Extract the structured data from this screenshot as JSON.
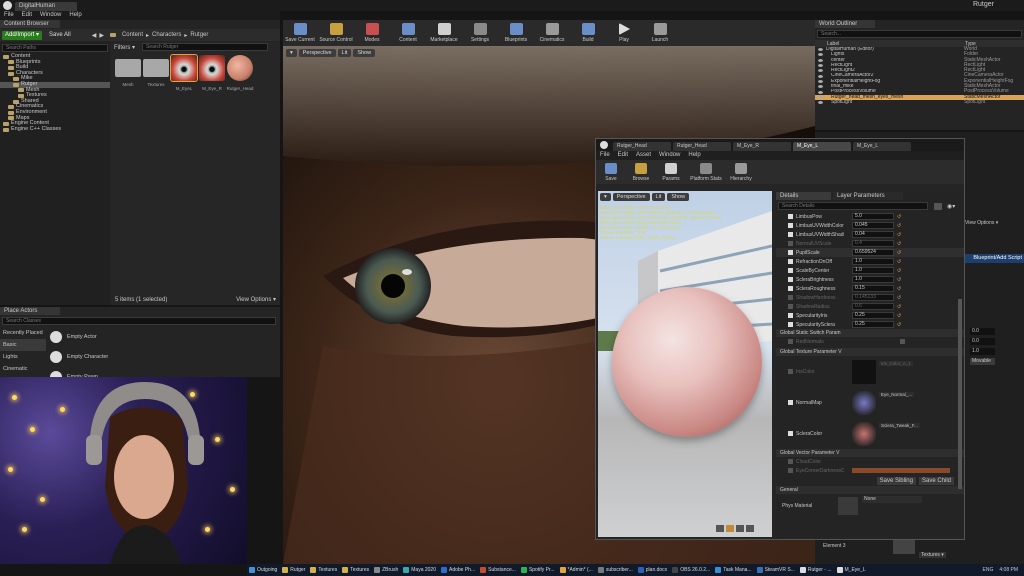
{
  "app": {
    "window_tab": "DigitalHuman",
    "user": "Rutger",
    "menu": [
      "File",
      "Edit",
      "Window",
      "Help"
    ]
  },
  "content_browser": {
    "tab": "Content Browser",
    "add_import": "Add/Import ▾",
    "save_all": "Save All",
    "breadcrumb": [
      "Content",
      "Characters",
      "Rutger"
    ],
    "filters": "Filters ▾",
    "search_assets_placeholder": "Search Rutger",
    "search_paths_placeholder": "Search Paths",
    "tree": [
      {
        "label": "Content",
        "depth": 0
      },
      {
        "label": "Blueprints",
        "depth": 1
      },
      {
        "label": "Build",
        "depth": 1
      },
      {
        "label": "Characters",
        "depth": 1
      },
      {
        "label": "Mike",
        "depth": 2
      },
      {
        "label": "Rutger",
        "depth": 2,
        "selected": true
      },
      {
        "label": "Mesh",
        "depth": 3
      },
      {
        "label": "Textures",
        "depth": 3
      },
      {
        "label": "Shared",
        "depth": 2
      },
      {
        "label": "Cinematics",
        "depth": 1
      },
      {
        "label": "Environment",
        "depth": 1
      },
      {
        "label": "Maps",
        "depth": 1
      },
      {
        "label": "Engine Content",
        "depth": 0
      },
      {
        "label": "Engine C++ Classes",
        "depth": 0
      }
    ],
    "assets": [
      {
        "label": "Mesh",
        "kind": "folder"
      },
      {
        "label": "Textures",
        "kind": "folder"
      },
      {
        "label": "M_EyeL",
        "kind": "eye",
        "selected": true
      },
      {
        "label": "M_Eye_R",
        "kind": "eye"
      },
      {
        "label": "Rutger_Head",
        "kind": "skin"
      }
    ],
    "status": "5 items (1 selected)",
    "view_options": "View Options ▾"
  },
  "place_actors": {
    "tab": "Place Actors",
    "search_placeholder": "Search Classes",
    "categories": [
      "Recently Placed",
      "Basic",
      "Lights",
      "Cinematic"
    ],
    "selected_category": "Basic",
    "actors": [
      "Empty Actor",
      "Empty Character",
      "Empty Pawn"
    ]
  },
  "toolbar": {
    "buttons": [
      "Save Current",
      "Source Control",
      "Modes",
      "Content",
      "Marketplace",
      "Settings",
      "Blueprints",
      "Cinematics",
      "Build",
      "Play",
      "Launch"
    ]
  },
  "viewport": {
    "chips": [
      "Perspective",
      "Lit",
      "Show"
    ]
  },
  "world_outliner": {
    "tab": "World Outliner",
    "search_placeholder": "Search...",
    "col_label": "Label",
    "col_type": "Type",
    "rows": [
      {
        "label": "DigitalHuman (Editor)",
        "type": "World"
      },
      {
        "label": "Lights",
        "type": "Folder"
      },
      {
        "label": "center",
        "type": "StaticMeshActor"
      },
      {
        "label": "RectLight",
        "type": "RectLight"
      },
      {
        "label": "RectLight2",
        "type": "RectLight"
      },
      {
        "label": "CineCameraActor2",
        "type": "CineCameraActor"
      },
      {
        "label": "ExponentialHeightFog",
        "type": "ExponentialHeightFog"
      },
      {
        "label": "final_mike",
        "type": "StaticMeshActor"
      },
      {
        "label": "PostProcessVolume",
        "type": "PostProcessVolume"
      },
      {
        "label": "Rutger_head_mesh_eyes_mesh",
        "type": "StaticMeshActor",
        "selected": true
      },
      {
        "label": "SpotLight",
        "type": "SpotLight"
      }
    ],
    "view_options": "View Options ▾",
    "blueprint_button": "Blueprint/Add Script",
    "movable": "Movable",
    "values": [
      "0.0",
      "0.0",
      "1.0"
    ],
    "element": "Element 3",
    "textures": "Textures ▾"
  },
  "material_editor": {
    "tabs": [
      "Rutger_Head",
      "Rutger_Head",
      "M_Eye_R",
      "M_Eye_L",
      "M_Eye_L"
    ],
    "active_tab": 3,
    "menu": [
      "File",
      "Edit",
      "Asset",
      "Window",
      "Help"
    ],
    "toolbar": [
      "Save",
      "Browse",
      "Params",
      "Platform Stats",
      "Hierarchy"
    ],
    "preview_chips": [
      "Perspective",
      "Lit",
      "Show"
    ],
    "stats": [
      "Base pass shader: 345 instructions",
      "Base pass shader with Surface Lightmap: 372 instructions",
      "Base pass shader with Volumetric Lightmap: 389 instructions",
      "Base pass vertex shader: 86 instructions",
      "Base pass vertex shader: 91 instructions",
      "Texture samplers: 7/16",
      "Texture Lookups (Est.): VS(0), PS(11)"
    ],
    "details_tabs": [
      "Details",
      "Layer Parameters"
    ],
    "search_details": "Search Details",
    "params": [
      {
        "label": "LimbusPow",
        "value": "5.0"
      },
      {
        "label": "LimbusUVWidthColor",
        "value": "0.045"
      },
      {
        "label": "LimbusUVWidthShading",
        "value": "0.04"
      },
      {
        "label": "NormalUVScale",
        "value": "0.4",
        "disabled": true
      },
      {
        "label": "PupilScale",
        "value": "0.659524",
        "highlight": true
      },
      {
        "label": "RefractionOnOff",
        "value": "1.0"
      },
      {
        "label": "ScaleByCenter",
        "value": "1.0"
      },
      {
        "label": "ScleraBrightness",
        "value": "1.0"
      },
      {
        "label": "ScleraRoughness",
        "value": "0.15"
      },
      {
        "label": "ShadowHardness",
        "value": "0.145133",
        "disabled": true
      },
      {
        "label": "ShadowRadius",
        "value": "0.6",
        "disabled": true
      },
      {
        "label": "SpecularityIris",
        "value": "0.25"
      },
      {
        "label": "SpecularitySclera",
        "value": "0.25"
      }
    ],
    "static_switch_section": "Global Static Switch Param",
    "static_switch_param": "RedNormals",
    "texture_section": "Global Texture Parameter V",
    "texture_params": [
      {
        "label": "IrisColor",
        "asset": "Iris_Color_A_1",
        "disabled": true
      },
      {
        "label": "NormalMap",
        "asset": "Eye_Normal_...",
        "color": "#7a78c8"
      },
      {
        "label": "ScleraColor",
        "asset": "Sclera_Tweak_F...",
        "color": "#c87470"
      }
    ],
    "vector_section": "Global Vector Parameter V",
    "vector_params": [
      "CloudColor",
      "EyeCornerDarknessCo"
    ],
    "save_sibling": "Save Sibling",
    "save_child": "Save Child",
    "general_section": "General",
    "phys_material": "Phys Material",
    "phys_value": "None"
  },
  "taskbar": [
    {
      "label": "Outgoing",
      "color": "#4a8fd4"
    },
    {
      "label": "Rutger",
      "color": "#d4b04a"
    },
    {
      "label": "Textures",
      "color": "#d4b04a"
    },
    {
      "label": "Textures",
      "color": "#d4b04a"
    },
    {
      "label": "ZBrush",
      "color": "#888888"
    },
    {
      "label": "Maya 2020",
      "color": "#3aa9a9"
    },
    {
      "label": "Adobe Ph...",
      "color": "#2f6bd4"
    },
    {
      "label": "Substance...",
      "color": "#c84a2a"
    },
    {
      "label": "Spotify Pr...",
      "color": "#2ab54a"
    },
    {
      "label": "*Admin* (...",
      "color": "#e6a33a"
    },
    {
      "label": "subscriber...",
      "color": "#777777"
    },
    {
      "label": "plan.docx",
      "color": "#2f5fb4"
    },
    {
      "label": "OBS 26.0.2...",
      "color": "#444444"
    },
    {
      "label": "Task Mana...",
      "color": "#3a8fd4"
    },
    {
      "label": "SteamVR S...",
      "color": "#3a6fb4"
    },
    {
      "label": "Rutger - ...",
      "color": "#dddddd"
    },
    {
      "label": "M_Eye_L",
      "color": "#dddddd"
    }
  ],
  "clock": {
    "time": "4:08 PM",
    "lang": "ENG"
  }
}
